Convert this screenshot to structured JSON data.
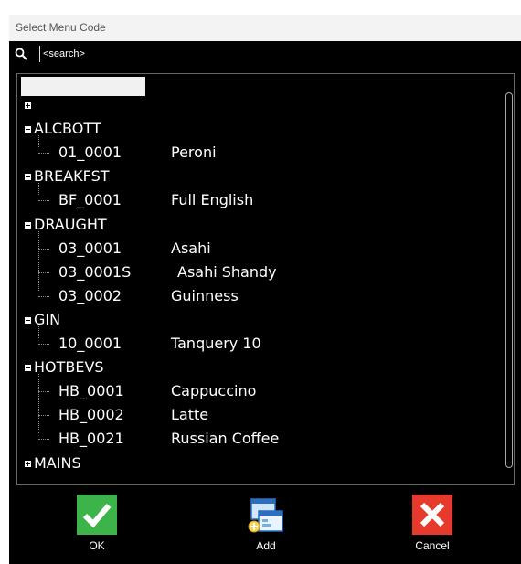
{
  "window": {
    "title": "Select Menu Code"
  },
  "search": {
    "placeholder": "<search>"
  },
  "tree": {
    "categories": [
      {
        "label": "",
        "expanded": false,
        "items": []
      },
      {
        "label": "ALCBOTT",
        "expanded": true,
        "items": [
          {
            "code": "01_0001",
            "desc": "Peroni"
          }
        ]
      },
      {
        "label": "BREAKFST",
        "expanded": true,
        "items": [
          {
            "code": "BF_0001",
            "desc": "Full English"
          }
        ]
      },
      {
        "label": "DRAUGHT",
        "expanded": true,
        "items": [
          {
            "code": "03_0001",
            "desc": "Asahi"
          },
          {
            "code": "03_0001S",
            "desc": "Asahi Shandy"
          },
          {
            "code": "03_0002",
            "desc": "Guinness"
          }
        ]
      },
      {
        "label": "GIN",
        "expanded": true,
        "items": [
          {
            "code": "10_0001",
            "desc": "Tanquery 10"
          }
        ]
      },
      {
        "label": "HOTBEVS",
        "expanded": true,
        "items": [
          {
            "code": "HB_0001",
            "desc": "Cappuccino"
          },
          {
            "code": "HB_0002",
            "desc": "Latte"
          },
          {
            "code": "HB_0021",
            "desc": "Russian Coffee"
          }
        ]
      },
      {
        "label": "MAINS",
        "expanded": false,
        "items": []
      }
    ]
  },
  "toolbar": {
    "ok_label": "OK",
    "add_label": "Add",
    "cancel_label": "Cancel"
  },
  "icons": {
    "search": "search-icon",
    "ok": "check-icon",
    "add": "add-windows-icon",
    "cancel": "close-icon"
  },
  "colors": {
    "ok": "#3cb44a",
    "cancel": "#e53a2c",
    "background": "#000000"
  }
}
